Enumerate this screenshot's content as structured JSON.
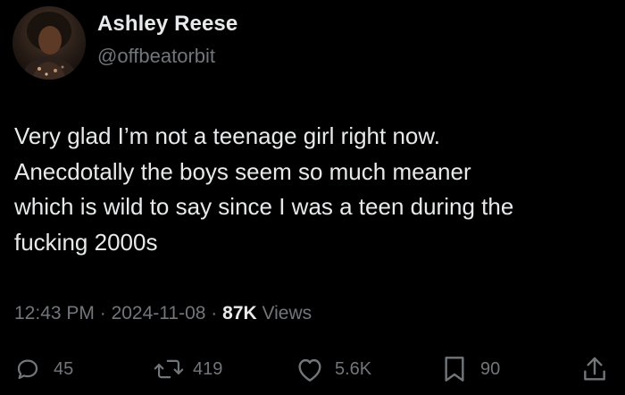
{
  "author": {
    "name": "Ashley Reese",
    "handle": "@offbeatorbit"
  },
  "tweet": {
    "text": "Very glad I’m not a teenage girl right now.\nAnecdotally the boys seem so much meaner\nwhich is wild to say since I was a teen during the\nfucking 2000s",
    "time": "12:43 PM",
    "sep1": "·",
    "date": "2024-11-08",
    "sep2": "·",
    "views_count": "87K",
    "views_label": "Views"
  },
  "actions": {
    "replies": "45",
    "reposts": "419",
    "likes": "5.6K",
    "bookmarks": "90"
  },
  "icons": {
    "reply": "reply-icon",
    "repost": "repost-icon",
    "like": "heart-icon",
    "bookmark": "bookmark-icon",
    "share": "share-icon"
  },
  "colors": {
    "background": "#000000",
    "primary_text": "#e7e9ea",
    "secondary_text": "#71767b"
  }
}
